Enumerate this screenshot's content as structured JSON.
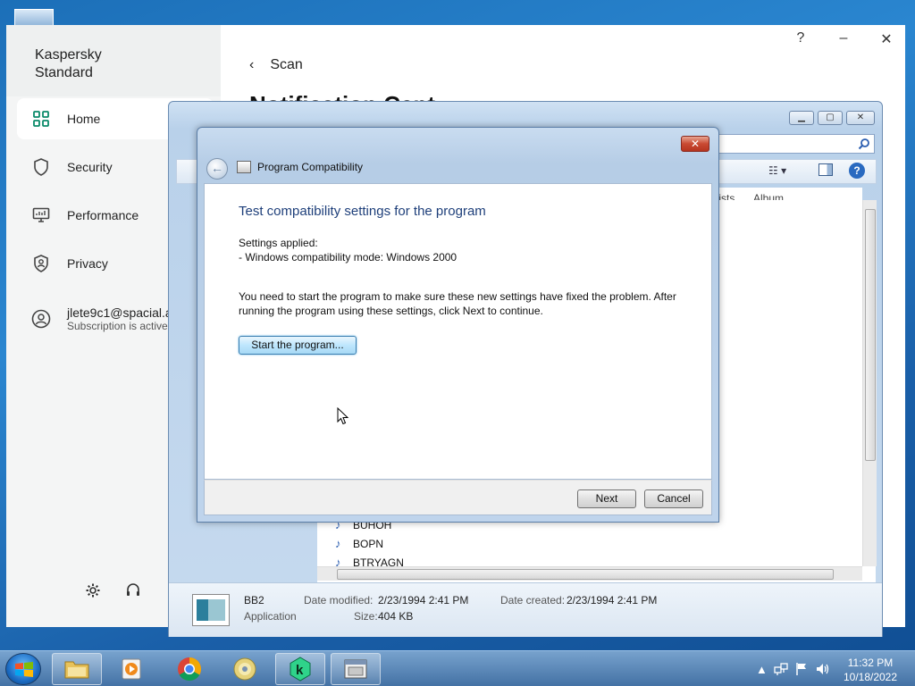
{
  "kaspersky": {
    "app_title": "Kaspersky Standard",
    "nav": [
      {
        "label": "Home",
        "icon": "grid-icon"
      },
      {
        "label": "Security",
        "icon": "shield-icon"
      },
      {
        "label": "Performance",
        "icon": "monitor-icon"
      },
      {
        "label": "Privacy",
        "icon": "privacy-shield-icon"
      }
    ],
    "account": {
      "email": "jlete9c1@spacial.a",
      "subscription": "Subscription is active"
    },
    "breadcrumb": "Scan",
    "page_heading": "Notification Cent",
    "window_controls": {
      "help": "?",
      "minimize": "–",
      "close": "✕"
    }
  },
  "explorer": {
    "columns": [
      "tists",
      "Album"
    ],
    "files": [
      "BUHOH",
      "BOPN",
      "BTRYAGN"
    ],
    "details": {
      "name": "BB2",
      "type": "Application",
      "date_modified_label": "Date modified:",
      "date_modified": "2/23/1994 2:41 PM",
      "date_created_label": "Date created:",
      "date_created": "2/23/1994 2:41 PM",
      "size_label": "Size:",
      "size": "404 KB"
    }
  },
  "dialog": {
    "window_title": "Program Compatibility",
    "heading": "Test compatibility settings for the program",
    "settings_label": "Settings applied:",
    "settings_value": "- Windows compatibility mode: Windows 2000",
    "instructions": "You need to start the program to make sure these new settings have fixed the problem. After running the program using these settings, click Next to continue.",
    "start_button": "Start the program...",
    "next_button": "Next",
    "cancel_button": "Cancel",
    "close_glyph": "✕"
  },
  "taskbar": {
    "time": "11:32 PM",
    "date": "10/18/2022"
  }
}
